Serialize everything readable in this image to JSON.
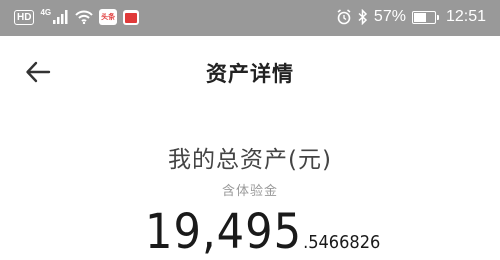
{
  "status_bar": {
    "hd_label": "HD",
    "network_label": "4G",
    "app_icon_label": "头条",
    "battery": "57%",
    "battery_level": 0.57,
    "time": "12:51",
    "icons": [
      "hd-icon",
      "signal-icon",
      "wifi-icon",
      "news-app-icon",
      "calendar-app-icon",
      "alarm-icon",
      "bluetooth-icon",
      "battery-icon"
    ]
  },
  "header": {
    "back_icon": "arrow-left-icon",
    "title": "资产详情"
  },
  "assets": {
    "label": "我的总资产(元)",
    "sublabel": "含体验金",
    "amount_integer": "19,495",
    "amount_decimal": ".5466826"
  },
  "colors": {
    "status_bar_bg": "#999999",
    "text_primary": "#1a1a1a",
    "text_secondary": "#9a9a9a"
  }
}
